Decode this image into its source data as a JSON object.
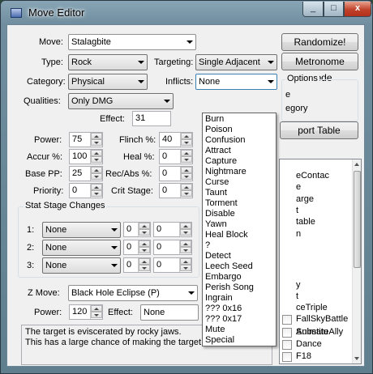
{
  "window": {
    "title": "Move Editor",
    "close_glyph": "x",
    "min_glyph": "_",
    "max_glyph": "□"
  },
  "move": {
    "label": "Move:",
    "value": "Stalagbite"
  },
  "type": {
    "label": "Type:",
    "value": "Rock"
  },
  "targeting": {
    "label": "Targeting:",
    "value": "Single Adjacent"
  },
  "category": {
    "label": "Category:",
    "value": "Physical"
  },
  "inflicts": {
    "label": "Inflicts:",
    "value": "None",
    "options": [
      "Burn",
      "Poison",
      "Confusion",
      "Attract",
      "Capture",
      "Nightmare",
      "Curse",
      "Taunt",
      "Torment",
      "Disable",
      "Yawn",
      "Heal Block",
      "?",
      "Detect",
      "Leech Seed",
      "Embargo",
      "Perish Song",
      "Ingrain",
      "??? 0x16",
      "??? 0x17",
      "Mute",
      "Special"
    ]
  },
  "qualities": {
    "label": "Qualities:",
    "value": "Only DMG"
  },
  "effect": {
    "label": "Effect:",
    "value": "31"
  },
  "power": {
    "label": "Power:",
    "value": "75"
  },
  "flinch": {
    "label": "Flinch %:",
    "value": "40"
  },
  "accuracy": {
    "label": "Accur %:",
    "value": "100"
  },
  "heal": {
    "label": "Heal %:",
    "value": "0"
  },
  "base_pp": {
    "label": "Base PP:",
    "value": "25"
  },
  "rec_abs": {
    "label": "Rec/Abs %:",
    "value": "0"
  },
  "priority": {
    "label": "Priority:",
    "value": "0"
  },
  "crit_stage": {
    "label": "Crit Stage:",
    "value": "0"
  },
  "stat_stage": {
    "title": "Stat Stage Changes",
    "rows": [
      {
        "label": "1:",
        "stat": "None",
        "stage": "0",
        "chance": "0"
      },
      {
        "label": "2:",
        "stat": "None",
        "stage": "0",
        "chance": "0"
      },
      {
        "label": "3:",
        "stat": "None",
        "stage": "0",
        "chance": "0"
      }
    ]
  },
  "z_move": {
    "label": "Z Move:",
    "value": "Black Hole Eclipse (P)"
  },
  "z_power": {
    "label": "Power:",
    "value": "120"
  },
  "z_effect": {
    "label": "Effect:",
    "value": "None"
  },
  "description": {
    "line1": "The target is eviscerated by rocky jaws.",
    "line2": "This has a large chance of making the target flinch."
  },
  "buttons": {
    "randomize": "Randomize!",
    "metronome": "Metronome Mode",
    "export": "port Table"
  },
  "options": {
    "title": "Options",
    "partial1": "e",
    "partial2": "egory"
  },
  "flags": {
    "visible": [
      {
        "text": "eContac"
      },
      {
        "text": "e"
      },
      {
        "text": "arge"
      },
      {
        "text": "t"
      },
      {
        "text": "table"
      },
      {
        "text": "n"
      },
      {
        "text": ""
      },
      {
        "text": ""
      },
      {
        "text": ""
      },
      {
        "text": "y"
      },
      {
        "text": "t"
      },
      {
        "text": "ceTriple"
      },
      {
        "text": ""
      },
      {
        "text": "Substitu"
      },
      {
        "text": "FallSkyBattle"
      },
      {
        "text": "AnimateAlly"
      },
      {
        "text": "Dance"
      },
      {
        "text": "F18"
      }
    ]
  }
}
